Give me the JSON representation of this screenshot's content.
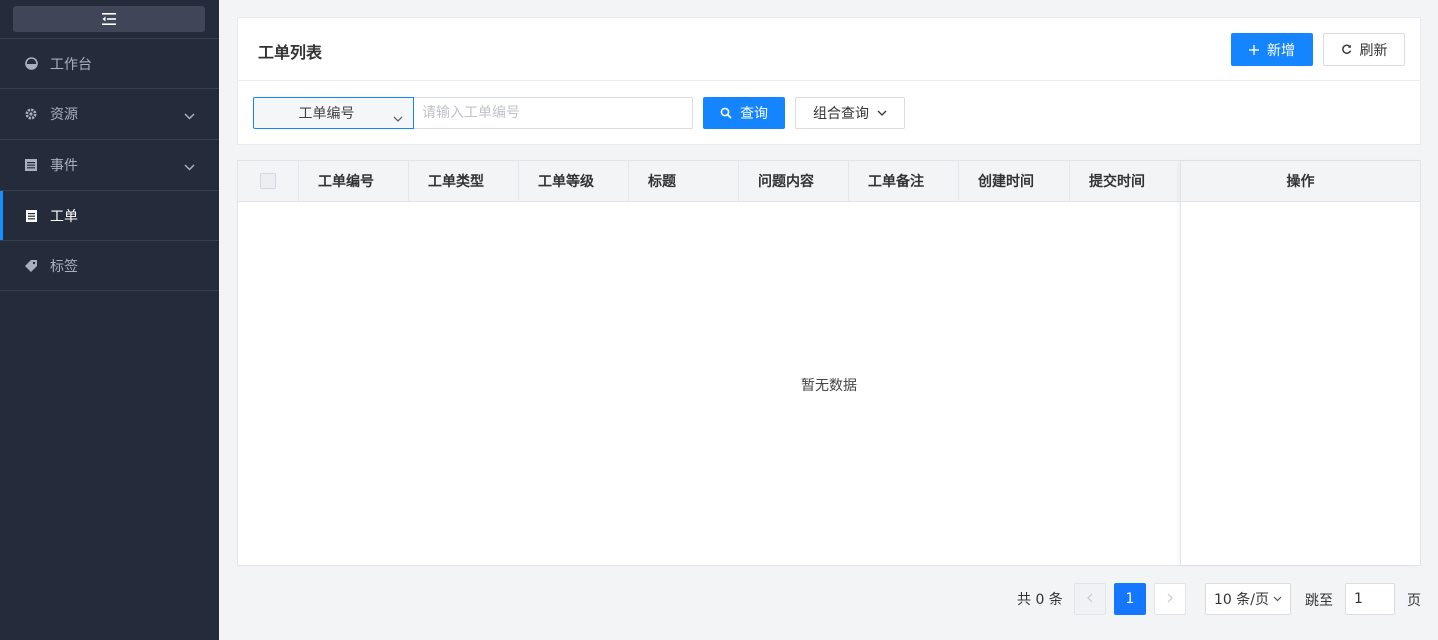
{
  "sidebar": {
    "items": [
      {
        "label": "工作台",
        "icon": "dashboard-icon",
        "active": false,
        "expandable": false
      },
      {
        "label": "资源",
        "icon": "gear-icon",
        "active": false,
        "expandable": true
      },
      {
        "label": "事件",
        "icon": "list-icon",
        "active": false,
        "expandable": true
      },
      {
        "label": "工单",
        "icon": "document-icon",
        "active": true,
        "expandable": false
      },
      {
        "label": "标签",
        "icon": "tag-icon",
        "active": false,
        "expandable": false
      }
    ]
  },
  "header": {
    "title": "工单列表",
    "add_label": "新增",
    "refresh_label": "刷新"
  },
  "search": {
    "field_selected": "工单编号",
    "placeholder": "请输入工单编号",
    "query_label": "查询",
    "combo_label": "组合查询"
  },
  "table": {
    "columns": [
      "工单编号",
      "工单类型",
      "工单等级",
      "标题",
      "问题内容",
      "工单备注",
      "创建时间",
      "提交时间"
    ],
    "action_column": "操作",
    "empty_text": "暂无数据",
    "rows": []
  },
  "pagination": {
    "total_text": "共 0 条",
    "current_page": "1",
    "page_size": "10 条/页",
    "jump_label": "跳至",
    "jump_value": "1",
    "page_label": "页"
  },
  "colors": {
    "sidebar_bg": "#242b3b",
    "primary": "#1585ff",
    "active_indicator": "#1890ff"
  }
}
